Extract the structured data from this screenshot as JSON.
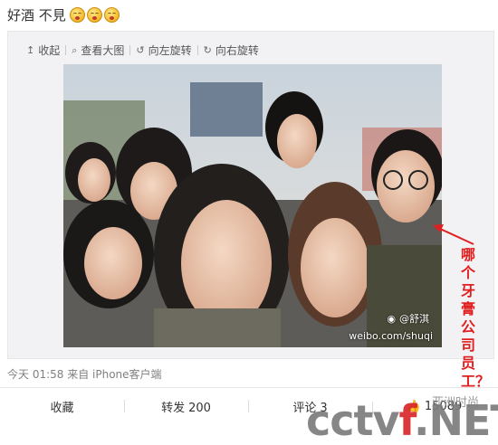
{
  "post": {
    "text": "好酒 不見",
    "emoji_count": 3,
    "emoji_icon": "drunk-face-emoji"
  },
  "toolbar": {
    "collapse": "收起",
    "view_large": "查看大图",
    "rotate_left": "向左旋转",
    "rotate_right": "向右旋转"
  },
  "photo": {
    "watermark_user": "@舒淇",
    "watermark_url": "weibo.com/shuqi"
  },
  "annotation": {
    "text": "哪个牙膏公司员工？",
    "color": "#e02020"
  },
  "meta": {
    "time_source": "今天 01:58 来自 iPhone客户端"
  },
  "actions": {
    "favorite": "收藏",
    "repost": "转发",
    "repost_count": "200",
    "comment": "评论",
    "comment_count": "3",
    "like_count": "15089"
  },
  "site_watermark": {
    "cn": "亚洲时尚",
    "logo_main": "cctv",
    "logo_accent": "f",
    "logo_tail": ".NET"
  }
}
